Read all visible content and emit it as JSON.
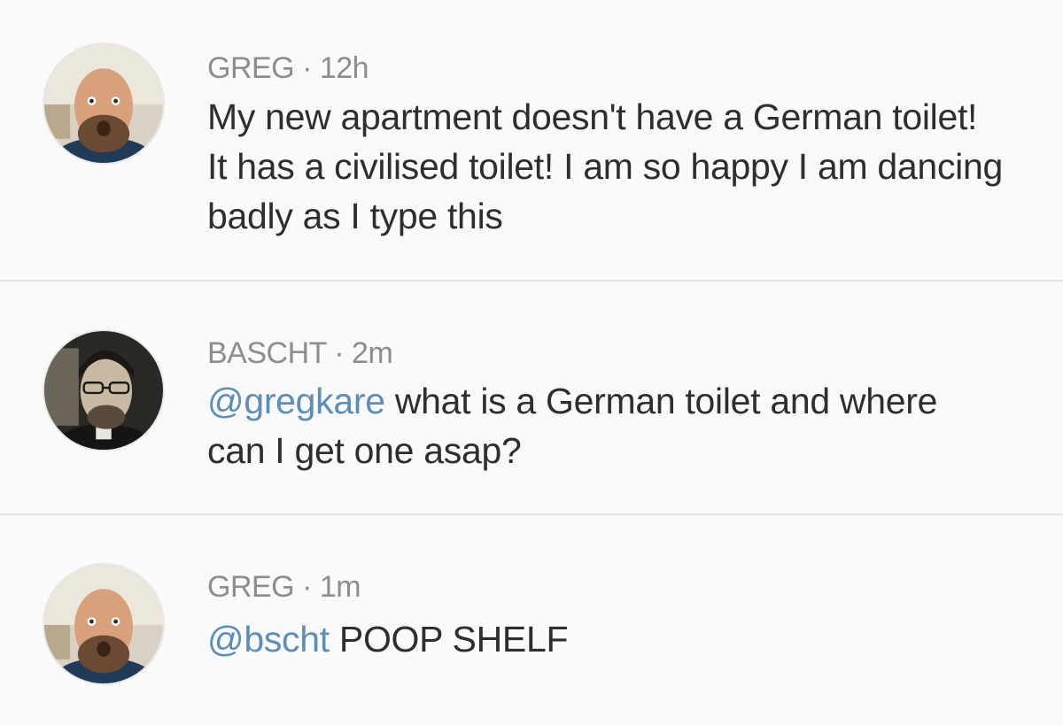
{
  "tweets": [
    {
      "author": "GREG",
      "separator": "·",
      "time": "12h",
      "mention": "",
      "text": "My new apartment doesn't have a German toilet! It has a civilised toilet! I am so happy I am dancing badly as I type this"
    },
    {
      "author": "BASCHT",
      "separator": "·",
      "time": "2m",
      "mention": "@gregkare",
      "text": " what is a German toilet and where can I get one asap?"
    },
    {
      "author": "GREG",
      "separator": "·",
      "time": "1m",
      "mention": "@bscht",
      "text": " POOP SHELF"
    }
  ],
  "colors": {
    "background": "#fafafa",
    "meta": "#8d8d8d",
    "body": "#2e2e2e",
    "mention": "#5b8fb9",
    "divider": "#e6e6e6"
  }
}
